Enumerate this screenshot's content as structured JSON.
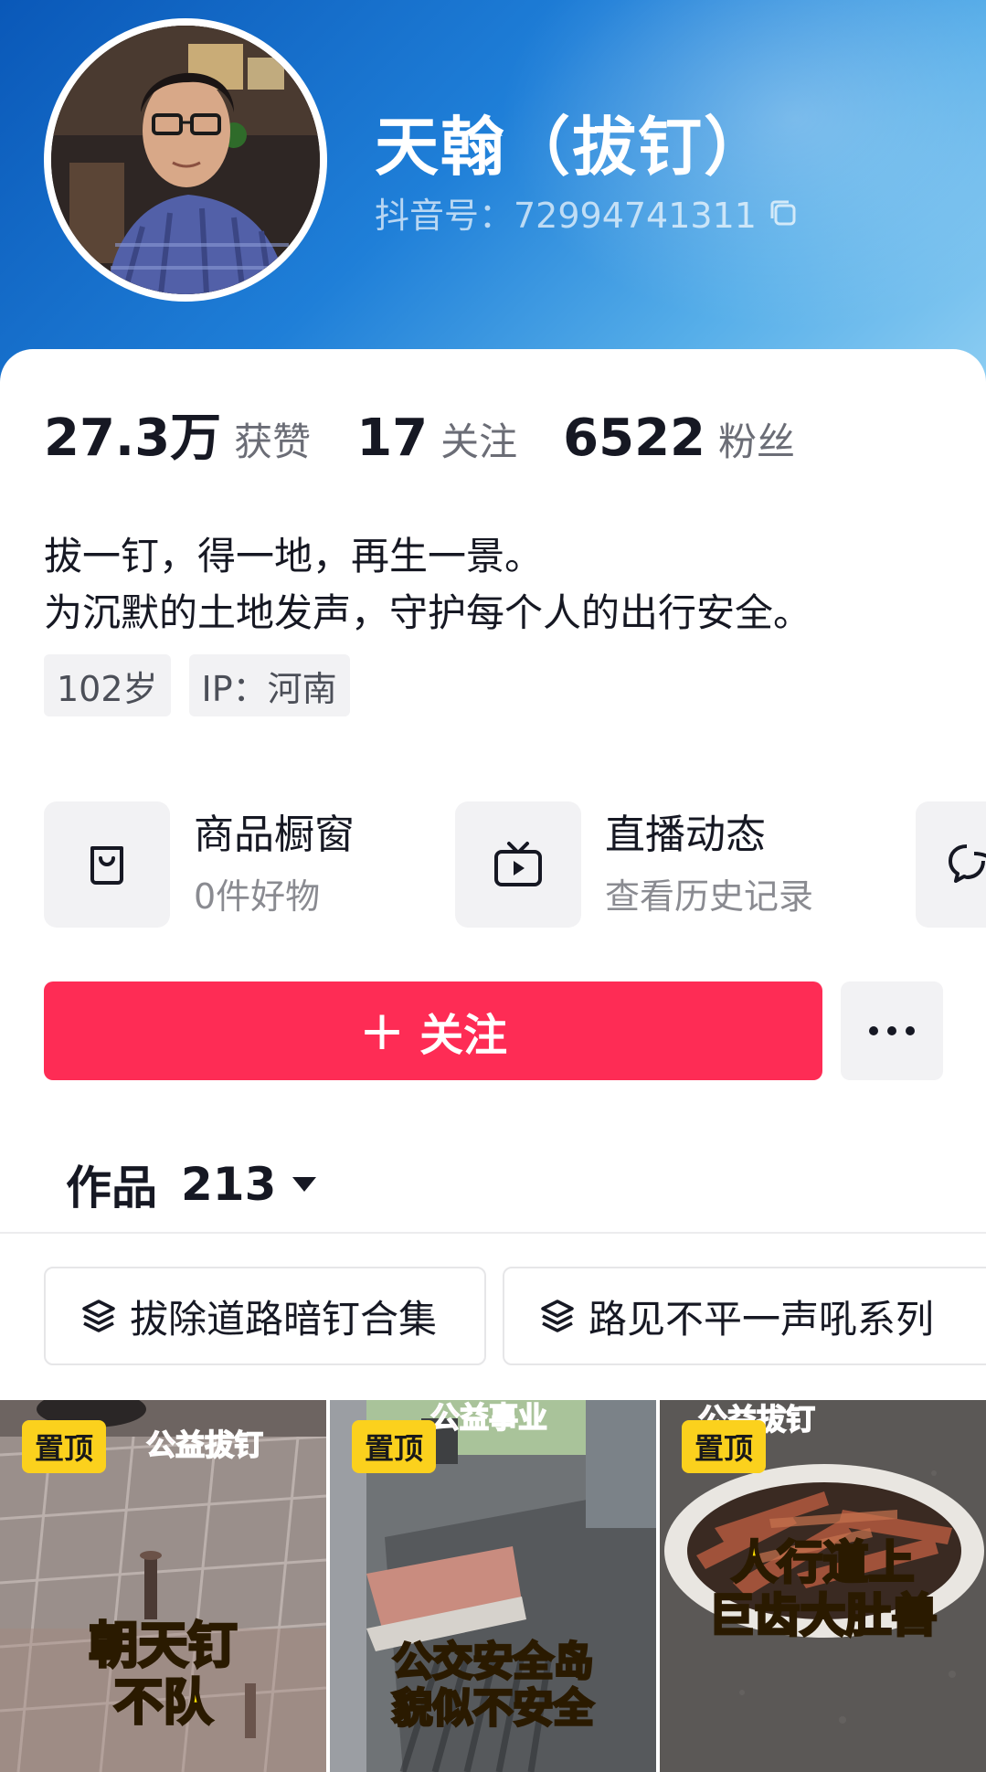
{
  "profile": {
    "nickname": "天翰（拔钉）",
    "douyin_id": "抖音号：72994741311",
    "stats": [
      {
        "value": "27.3万",
        "label": "获赞"
      },
      {
        "value": "17",
        "label": "关注"
      },
      {
        "value": "6522",
        "label": "粉丝"
      }
    ],
    "bio_lines": [
      "拔一钉，得一地，再生一景。",
      "为沉默的土地发声，守护每个人的出行安全。"
    ],
    "tags": [
      "102岁",
      "IP：河南"
    ]
  },
  "services": [
    {
      "title": "商品橱窗",
      "subtitle": "0件好物",
      "icon": "shopping-bag-icon"
    },
    {
      "title": "直播动态",
      "subtitle": "查看历史记录",
      "icon": "tv-play-icon"
    },
    {
      "title": "",
      "subtitle": "",
      "icon": "chat-bubble-icon"
    }
  ],
  "actions": {
    "follow_plus": "+",
    "follow_label": "关注",
    "more_icon": "more-dots-icon"
  },
  "works": {
    "label": "作品",
    "count": "213"
  },
  "collections": [
    {
      "title": "拔除道路暗钉合集",
      "icon": "stack-layers-icon"
    },
    {
      "title": "路见不平一声吼系列",
      "icon": "stack-layers-icon"
    }
  ],
  "videos": [
    {
      "pin": "置顶",
      "top_text": "公益拔钉",
      "caption_lines": [
        "朝天钉",
        "不队"
      ]
    },
    {
      "pin": "置顶",
      "top_text": "公益事业",
      "caption_lines": [
        "公交安全岛",
        "貌似不安全"
      ]
    },
    {
      "pin": "置顶",
      "top_text": "公益拔钉",
      "caption_lines": [
        "人行道上",
        "巨齿大肚兽"
      ]
    }
  ],
  "colors": {
    "follow_button": "#fe2c55",
    "pin_badge": "#fbd11d",
    "header_gradient_start": "#0a58b8",
    "header_gradient_end": "#8ccdf2"
  }
}
